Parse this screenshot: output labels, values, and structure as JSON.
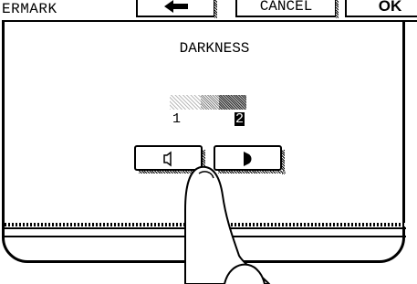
{
  "window": {
    "title": "ERMARK"
  },
  "toolbar": {
    "back_icon": "left-arrow-icon",
    "cancel_label": "CANCEL",
    "ok_label": "OK"
  },
  "darkness": {
    "heading": "DARKNESS",
    "min_label": "1",
    "max_label": "2",
    "current_level": 2,
    "scale_min": 1,
    "scale_max": 2
  },
  "controls": {
    "lighter_icon": "lighter-icon",
    "darker_icon": "darker-icon"
  },
  "colors": {
    "ink": "#000000",
    "paper": "#ffffff"
  }
}
